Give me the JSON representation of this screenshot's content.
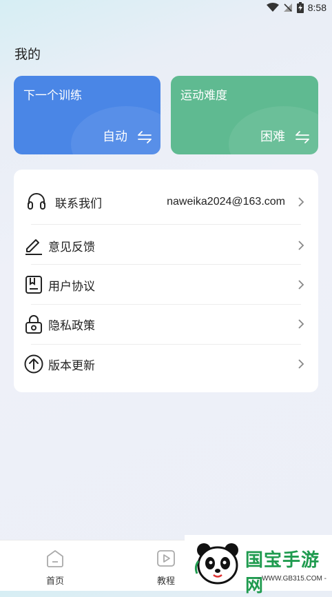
{
  "status_bar": {
    "time": "8:58"
  },
  "page": {
    "title": "我的"
  },
  "cards": [
    {
      "title": "下一个训练",
      "value": "自动",
      "color": "#4a86e6",
      "icon": "swap-icon"
    },
    {
      "title": "运动难度",
      "value": "困难",
      "color": "#5fba91",
      "icon": "swap-icon"
    }
  ],
  "menu": [
    {
      "label": "联系我们",
      "value": "naweika2024@163.com",
      "icon": "headset-icon"
    },
    {
      "label": "意见反馈",
      "icon": "pencil-icon"
    },
    {
      "label": "用户协议",
      "icon": "agreement-icon"
    },
    {
      "label": "隐私政策",
      "icon": "lock-icon"
    },
    {
      "label": "版本更新",
      "icon": "upload-arrow-icon"
    }
  ],
  "tabbar": [
    {
      "label": "首页",
      "icon": "home-icon"
    },
    {
      "label": "教程",
      "icon": "play-icon"
    }
  ],
  "watermark": {
    "text": "国宝手游网",
    "url": "- WWW.GB315.COM -"
  }
}
